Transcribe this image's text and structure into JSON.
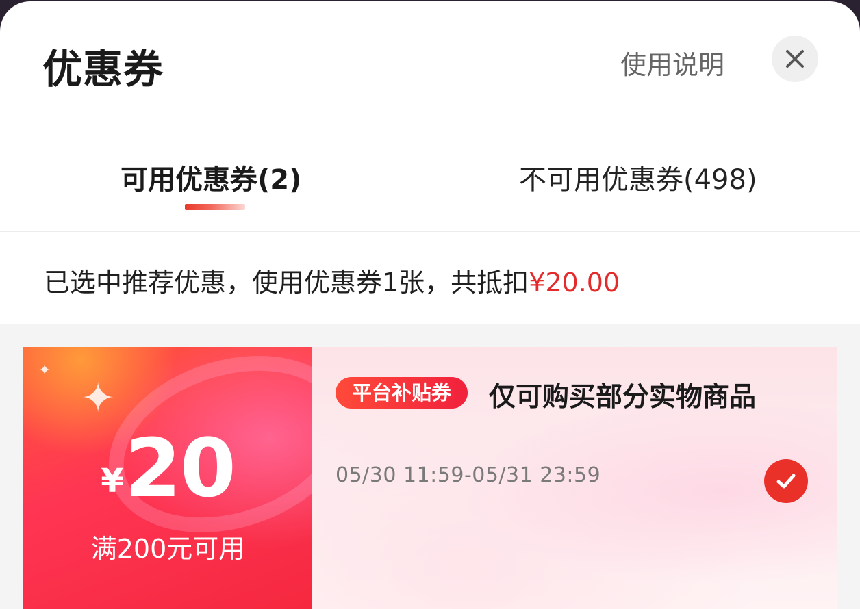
{
  "header": {
    "title": "优惠券",
    "help_label": "使用说明",
    "close_icon": "close-icon"
  },
  "tabs": [
    {
      "label": "可用优惠券(2)",
      "active": true
    },
    {
      "label": "不可用优惠券(498)",
      "active": false
    }
  ],
  "summary": {
    "text": "已选中推荐优惠，使用优惠券1张，共抵扣",
    "amount": "¥20.00"
  },
  "coupons": [
    {
      "currency_symbol": "¥",
      "amount": "20",
      "threshold": "满200元可用",
      "tag": "平台补贴券",
      "description": "仅可购买部分实物商品",
      "validity": "05/30 11:59-05/31 23:59",
      "selected": true,
      "check_icon": "check-circle-icon"
    }
  ],
  "colors": {
    "accent": "#e42b2b",
    "coupon_left": "#f5283f",
    "coupon_right_bg": "#fde3e8",
    "tab_indicator": "#e8392c"
  }
}
